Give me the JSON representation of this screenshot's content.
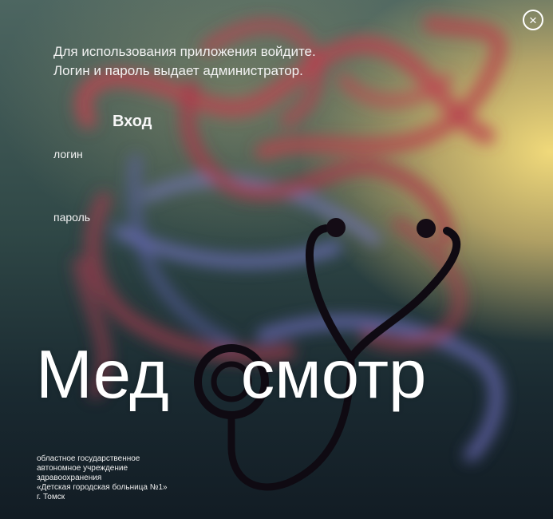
{
  "window": {
    "close_icon": "×"
  },
  "intro": {
    "line1": "Для использования приложения войдите.",
    "line2": "Логин и пароль  выдает администратор."
  },
  "login_form": {
    "title": "Вход",
    "login_label": "логин",
    "login_value": "",
    "password_label": "пароль",
    "password_value": ""
  },
  "logo": {
    "text_start": "Мед",
    "text_end": "смотр",
    "icon": "stethoscope-icon"
  },
  "organization": {
    "line1": "областное государственное",
    "line2": "автономное учреждение",
    "line3": "здравоохранения",
    "line4": "«Детская городская больница №1»",
    "line5": "г. Томск"
  },
  "colors": {
    "background_top": "#4d6661",
    "background_bottom": "#121c24",
    "accent_yellow": "#f0d97a",
    "stethoscope": "#0f0a12",
    "text": "#ffffff"
  }
}
